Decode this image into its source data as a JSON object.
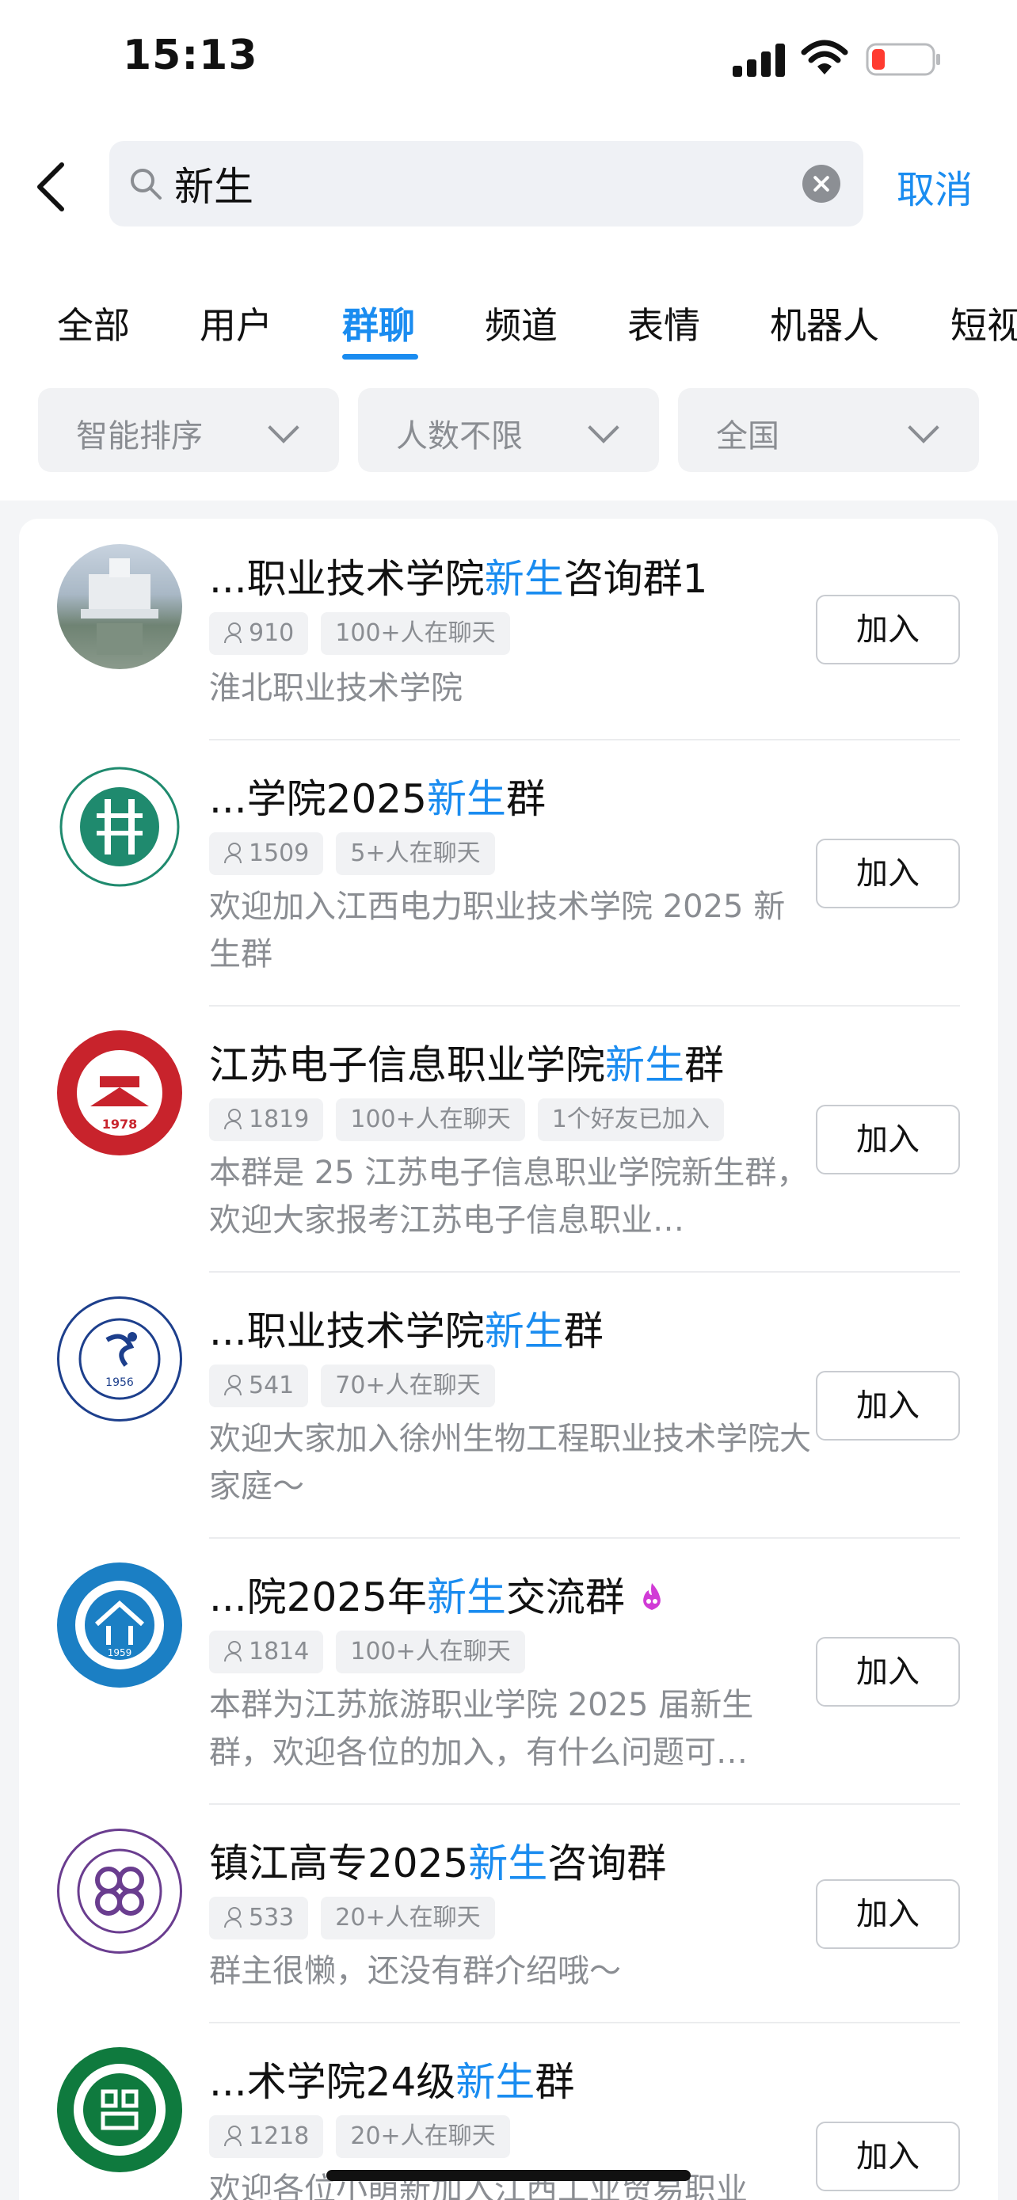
{
  "status_bar": {
    "time": "15:13"
  },
  "search": {
    "value": "新生",
    "cancel_label": "取消"
  },
  "tabs": [
    {
      "label": "全部"
    },
    {
      "label": "用户"
    },
    {
      "label": "群聊",
      "active": true
    },
    {
      "label": "频道"
    },
    {
      "label": "表情"
    },
    {
      "label": "机器人"
    },
    {
      "label": "短视"
    }
  ],
  "filters": [
    {
      "label": "智能排序"
    },
    {
      "label": "人数不限"
    },
    {
      "label": "全国"
    }
  ],
  "accent_color": "#1a8cf0",
  "results": [
    {
      "title_pre": "...职业技术学院",
      "title_hl": "新生",
      "title_post": "咨询群1",
      "members": "910",
      "tags": [
        "100+人在聊天"
      ],
      "desc": "淮北职业技术学院",
      "join_label": "加入"
    },
    {
      "title_pre": "...学院2025",
      "title_hl": "新生",
      "title_post": "群",
      "members": "1509",
      "tags": [
        "5+人在聊天"
      ],
      "desc": "欢迎加入江西电力职业技术学院 2025 新生群",
      "join_label": "加入"
    },
    {
      "title_pre": "江苏电子信息职业学院",
      "title_hl": "新生",
      "title_post": "群",
      "members": "1819",
      "tags": [
        "100+人在聊天",
        "1个好友已加入"
      ],
      "desc": "本群是 25 江苏电子信息职业学院新生群，欢迎大家报考江苏电子信息职业…",
      "join_label": "加入"
    },
    {
      "title_pre": "...职业技术学院",
      "title_hl": "新生",
      "title_post": "群",
      "members": "541",
      "tags": [
        "70+人在聊天"
      ],
      "desc": "欢迎大家加入徐州生物工程职业技术学院大家庭～",
      "join_label": "加入"
    },
    {
      "title_pre": "...院2025年",
      "title_hl": "新生",
      "title_post": "交流群",
      "members": "1814",
      "tags": [
        "100+人在聊天"
      ],
      "desc": "本群为江苏旅游职业学院 2025 届新生群，欢迎各位的加入，有什么问题可…",
      "join_label": "加入"
    },
    {
      "title_pre": "镇江高专2025",
      "title_hl": "新生",
      "title_post": "咨询群",
      "members": "533",
      "tags": [
        "20+人在聊天"
      ],
      "desc": "群主很懒，还没有群介绍哦～",
      "join_label": "加入"
    },
    {
      "title_pre": "...术学院24级",
      "title_hl": "新生",
      "title_post": "群",
      "members": "1218",
      "tags": [
        "20+人在聊天"
      ],
      "desc": "欢迎各位小萌新加入江西工业贸易职业",
      "join_label": "加入"
    }
  ],
  "avatar_texts": [
    "1978",
    "1956",
    "1959"
  ]
}
